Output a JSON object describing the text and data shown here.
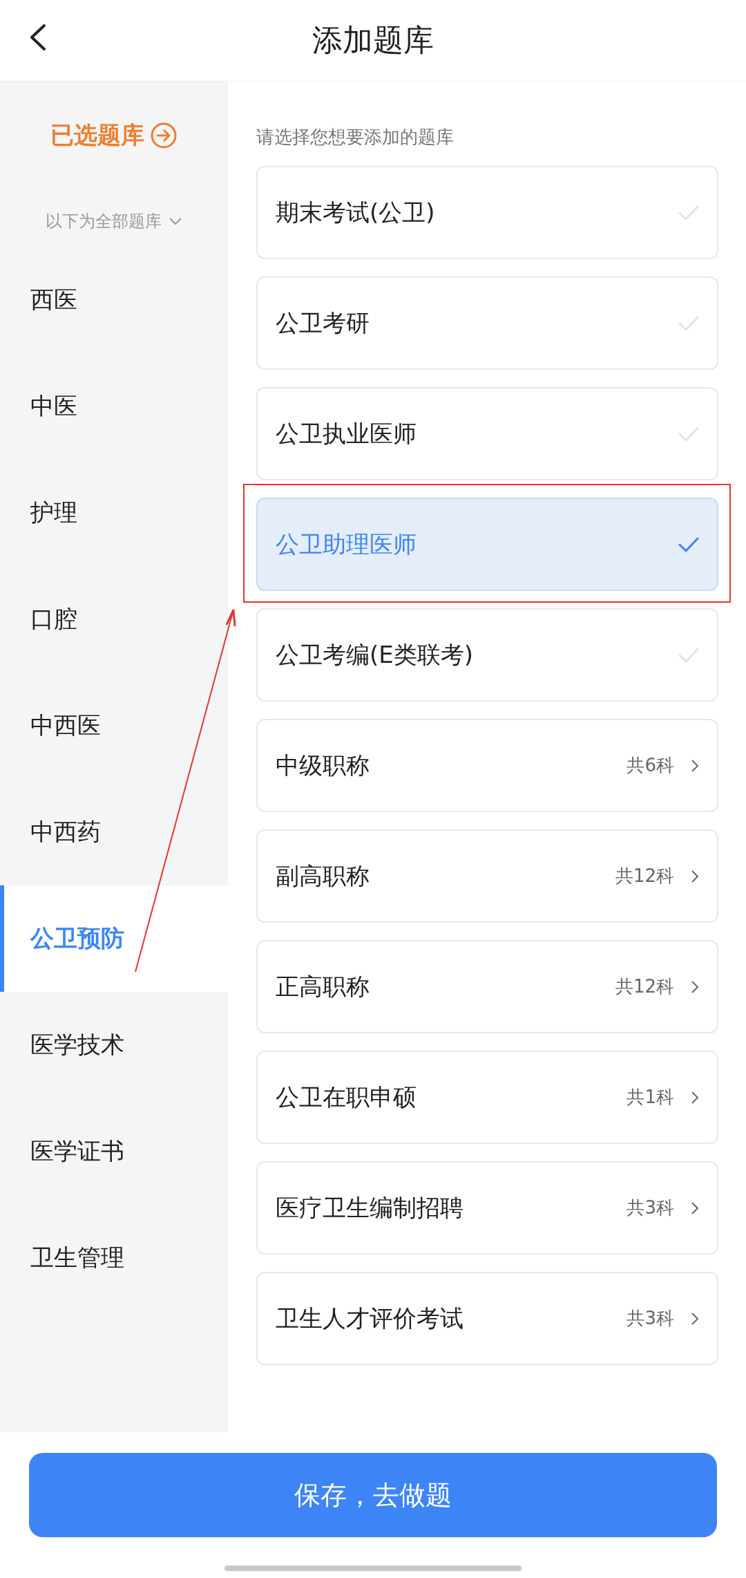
{
  "header": {
    "title": "添加题库"
  },
  "sidebar": {
    "selected_link": {
      "label": "已选题库"
    },
    "filter": {
      "label": "以下为全部题库"
    },
    "items": [
      {
        "label": "西医",
        "selected": false
      },
      {
        "label": "中医",
        "selected": false
      },
      {
        "label": "护理",
        "selected": false
      },
      {
        "label": "口腔",
        "selected": false
      },
      {
        "label": "中西医",
        "selected": false
      },
      {
        "label": "中西药",
        "selected": false
      },
      {
        "label": "公卫预防",
        "selected": true
      },
      {
        "label": "医学技术",
        "selected": false
      },
      {
        "label": "医学证书",
        "selected": false
      },
      {
        "label": "卫生管理",
        "selected": false
      }
    ]
  },
  "content": {
    "hint": "请选择您想要添加的题库",
    "cards": [
      {
        "kind": "check",
        "label": "期末考试(公卫)",
        "selected": false
      },
      {
        "kind": "check",
        "label": "公卫考研",
        "selected": false
      },
      {
        "kind": "check",
        "label": "公卫执业医师",
        "selected": false
      },
      {
        "kind": "check",
        "label": "公卫助理医师",
        "selected": true
      },
      {
        "kind": "check",
        "label": "公卫考编(E类联考)",
        "selected": false
      },
      {
        "kind": "group",
        "label": "中级职称",
        "count": "共6科"
      },
      {
        "kind": "group",
        "label": "副高职称",
        "count": "共12科"
      },
      {
        "kind": "group",
        "label": "正高职称",
        "count": "共12科"
      },
      {
        "kind": "group",
        "label": "公卫在职申硕",
        "count": "共1科"
      },
      {
        "kind": "group",
        "label": "医疗卫生编制招聘",
        "count": "共3科"
      },
      {
        "kind": "group",
        "label": "卫生人才评价考试",
        "count": "共3科"
      }
    ]
  },
  "save_button": {
    "label": "保存，去做题"
  },
  "annotations": {
    "highlight_box": true,
    "pointer_arrow": true
  }
}
